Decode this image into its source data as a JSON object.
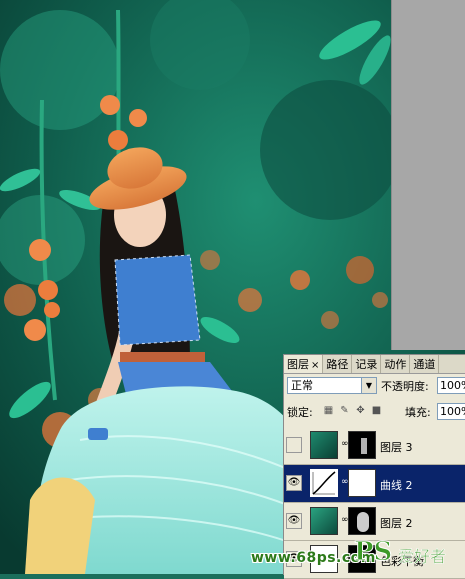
{
  "panel": {
    "tabs": [
      {
        "label": "图层",
        "active": true,
        "close": "×"
      },
      {
        "label": "路径",
        "active": false
      },
      {
        "label": "记录",
        "active": false
      },
      {
        "label": "动作",
        "active": false
      },
      {
        "label": "通道",
        "active": false
      }
    ],
    "blend_mode": "正常",
    "opacity_label": "不透明度:",
    "opacity_value": "100%",
    "lock_label": "锁定:",
    "fill_label": "填充:",
    "fill_value": "100%",
    "layers": [
      {
        "name": "图层 3",
        "visible": false,
        "selected": false
      },
      {
        "name": "曲线 2",
        "visible": true,
        "selected": true
      },
      {
        "name": "图层 2",
        "visible": true,
        "selected": false
      },
      {
        "name": "色彩平衡",
        "visible": true,
        "selected": false
      }
    ]
  },
  "watermark": {
    "url_text": "www.68ps.com",
    "logo_text": "爱好者",
    "logo_prefix": "PS"
  },
  "colors": {
    "selection": "#0a246a",
    "panel_bg": "#ece9d8",
    "teal": "#1b8a6f",
    "orange": "#e8753a"
  }
}
